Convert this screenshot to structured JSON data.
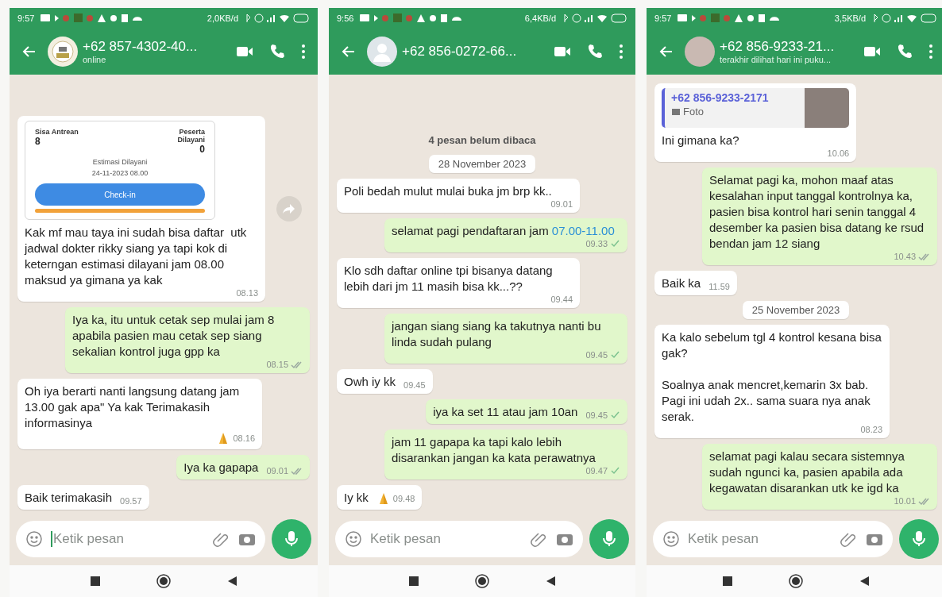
{
  "phones": [
    {
      "status_bar": {
        "time": "9:57",
        "speed": "2,0KB/d"
      },
      "header": {
        "name": "+62 857-4302-40...",
        "subtitle": "online",
        "avatar": {
          "kind": "logo"
        }
      },
      "messages": [
        {
          "kind": "card",
          "card": {
            "left_label": "Sisa Antrean",
            "left_value": "8",
            "right_label": "Peserta Dilayani",
            "right_value": "0",
            "estimate_label": "Estimasi Dilayani",
            "estimate_value": "24-11-2023 08.00",
            "button": "Check-in"
          },
          "text": "Kak mf mau taya ini sudah bisa daftar  utk jadwal dokter rikky siang ya tapi kok di keterngan estimasi dilayani jam 08.00 maksud ya gimana ya kak",
          "time": "08.13"
        },
        {
          "kind": "outgoing",
          "text": "Iya ka, itu untuk cetak sep mulai jam 8 apabila pasien mau cetak sep siang sekalian kontrol juga gpp ka",
          "time": "08.15",
          "ticks": {
            "kind": "double"
          }
        },
        {
          "kind": "incoming",
          "text": "Oh iya berarti nanti langsung datang jam 13.00 gak apa\" Ya kak Terimakasih informasinya",
          "praying_hands": true,
          "time": "08.16"
        },
        {
          "kind": "outgoing",
          "text": "Iya ka gapapa",
          "time": "09.01",
          "ticks": {
            "kind": "double"
          }
        },
        {
          "kind": "incoming",
          "text": "Baik terimakasih",
          "time": "09.57"
        }
      ],
      "input": {
        "placeholder": "Ketik pesan",
        "cursor": true
      }
    },
    {
      "status_bar": {
        "time": "9:56",
        "speed": "6,4KB/d"
      },
      "header": {
        "name": "+62 856-0272-66...",
        "avatar": {
          "kind": "silhouette"
        }
      },
      "messages": [
        {
          "kind": "unread",
          "text": "4 pesan belum dibaca"
        },
        {
          "kind": "date",
          "text": "28 November 2023"
        },
        {
          "kind": "incoming",
          "text": "Poli bedah mulut mulai buka jm brp kk..",
          "time": "09.01"
        },
        {
          "kind": "outgoing",
          "text": "selamat pagi pendaftaran jam",
          "link": "07.00-11.00",
          "time": "09.33",
          "ticks": {
            "kind": "single"
          }
        },
        {
          "kind": "incoming",
          "text": "Klo sdh daftar online tpi bisanya datang lebih dari jm 11 masih bisa kk...??",
          "time": "09.44"
        },
        {
          "kind": "outgoing",
          "text": "jangan siang siang ka takutnya nanti bu linda sudah pulang",
          "time": "09.45",
          "ticks": {
            "kind": "single"
          }
        },
        {
          "kind": "incoming",
          "text": "Owh iy kk",
          "time": "09.45"
        },
        {
          "kind": "outgoing",
          "text": "iya ka set 11 atau jam 10an",
          "time": "09.45",
          "ticks": {
            "kind": "single"
          }
        },
        {
          "kind": "outgoing",
          "text": "jam 11 gapapa ka tapi kalo lebih disarankan jangan ka kata perawatnya",
          "time": "09.47",
          "ticks": {
            "kind": "single"
          }
        },
        {
          "kind": "incoming",
          "text": "Iy kk",
          "praying_hands": true,
          "time": "09.48"
        }
      ],
      "input": {
        "placeholder": "Ketik pesan",
        "cursor": false
      }
    },
    {
      "status_bar": {
        "time": "9:57",
        "speed": "3,5KB/d"
      },
      "header": {
        "name": "+62 856-9233-21...",
        "subtitle": "terakhir dilihat hari ini puku...",
        "avatar": {
          "kind": "photo"
        }
      },
      "messages": [
        {
          "kind": "quote",
          "quote": {
            "author": "+62 856-9233-2171",
            "label": "Foto"
          },
          "text": "Ini gimana ka?",
          "time": "10.06"
        },
        {
          "kind": "outgoing",
          "text": "Selamat pagi ka, mohon maaf atas kesalahan input tanggal kontrolnya ka, pasien bisa kontrol hari senin tanggal 4 desember ka pasien bisa datang ke rsud bendan jam 12 siang",
          "time": "10.43",
          "ticks": {
            "kind": "double"
          }
        },
        {
          "kind": "incoming",
          "text": "Baik ka",
          "time": "11.59"
        },
        {
          "kind": "date",
          "text": "25 November 2023"
        },
        {
          "kind": "incoming",
          "text": "Ka kalo sebelum tgl 4 kontrol kesana bisa gak?\n\nSoalnya anak mencret,kemarin 3x bab. Pagi ini udah 2x.. sama suara nya anak serak.",
          "time": "08.23"
        },
        {
          "kind": "outgoing",
          "text": "selamat pagi kalau secara sistemnya sudah ngunci ka, pasien apabila ada kegawatan disarankan utk ke igd ka",
          "time": "10.01",
          "ticks": {
            "kind": "double"
          }
        }
      ],
      "input": {
        "placeholder": "Ketik pesan",
        "cursor": false
      }
    }
  ]
}
